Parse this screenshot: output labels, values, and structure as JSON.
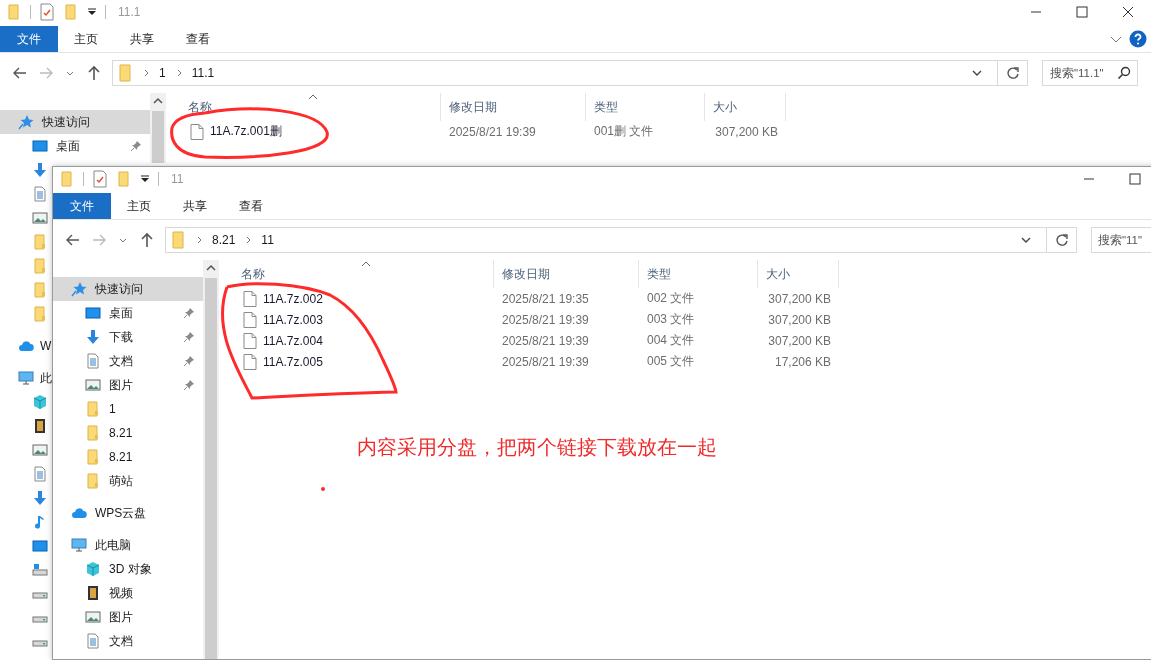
{
  "windows": [
    {
      "title": "11.1",
      "ribbon_tabs": [
        {
          "label": "文件",
          "selected": true
        },
        {
          "label": "主页",
          "selected": false
        },
        {
          "label": "共享",
          "selected": false
        },
        {
          "label": "查看",
          "selected": false
        }
      ],
      "path": [
        "1",
        "11.1"
      ],
      "search": {
        "placeholder": "搜索\"11.1\""
      },
      "nav": [
        {
          "kind": "quick",
          "label": "快速访问",
          "selected": true,
          "children": [
            {
              "kind": "desktop",
              "label": "桌面",
              "pinned": true,
              "selected": false
            },
            {
              "kind": "download",
              "selected": false
            },
            {
              "kind": "doc",
              "selected": false
            },
            {
              "kind": "picture",
              "selected": false
            },
            {
              "kind": "folder",
              "selected": false
            },
            {
              "kind": "folder",
              "selected": false
            },
            {
              "kind": "folder",
              "selected": false
            },
            {
              "kind": "folder",
              "selected": false
            }
          ]
        },
        {
          "kind": "cloud",
          "label": "W",
          "selected": false
        },
        {
          "kind": "pc",
          "label": "此",
          "selected": false,
          "children": [
            {
              "kind": "cube",
              "selected": false
            },
            {
              "kind": "video",
              "selected": false
            },
            {
              "kind": "picture",
              "selected": false
            },
            {
              "kind": "doc",
              "selected": false
            },
            {
              "kind": "download",
              "selected": false
            },
            {
              "kind": "music",
              "selected": false
            },
            {
              "kind": "desktop",
              "selected": false
            },
            {
              "kind": "windrive",
              "selected": false
            },
            {
              "kind": "drive",
              "selected": false
            },
            {
              "kind": "drive",
              "selected": false
            },
            {
              "kind": "drive",
              "selected": false
            }
          ]
        }
      ],
      "columns": [
        "名称",
        "修改日期",
        "类型",
        "大小"
      ],
      "files": [
        {
          "name": "11A.7z.001删",
          "date": "2025/8/21 19:39",
          "type": "001删 文件",
          "size": "307,200 KB"
        }
      ]
    },
    {
      "title": "11",
      "ribbon_tabs": [
        {
          "label": "文件",
          "selected": true
        },
        {
          "label": "主页",
          "selected": false
        },
        {
          "label": "共享",
          "selected": false
        },
        {
          "label": "查看",
          "selected": false
        }
      ],
      "path": [
        "8.21",
        "11"
      ],
      "search": {
        "placeholder": "搜索\"11\""
      },
      "nav": [
        {
          "kind": "quick",
          "label": "快速访问",
          "selected": true,
          "children": [
            {
              "kind": "desktop",
              "label": "桌面",
              "pinned": true,
              "selected": false
            },
            {
              "kind": "download",
              "label": "下载",
              "pinned": true,
              "selected": false
            },
            {
              "kind": "doc",
              "label": "文档",
              "pinned": true,
              "selected": false
            },
            {
              "kind": "picture",
              "label": "图片",
              "pinned": true,
              "selected": false
            },
            {
              "kind": "folder",
              "label": "1",
              "pinned": false,
              "selected": false
            },
            {
              "kind": "folder",
              "label": "8.21",
              "pinned": false,
              "selected": false
            },
            {
              "kind": "folder",
              "label": "8.21",
              "pinned": false,
              "selected": false
            },
            {
              "kind": "folder",
              "label": "萌站",
              "pinned": false,
              "selected": false
            }
          ]
        },
        {
          "kind": "cloud",
          "label": "WPS云盘",
          "selected": false
        },
        {
          "kind": "pc",
          "label": "此电脑",
          "selected": false,
          "children": [
            {
              "kind": "cube",
              "label": "3D 对象",
              "selected": false
            },
            {
              "kind": "video",
              "label": "视频",
              "selected": false
            },
            {
              "kind": "picture",
              "label": "图片",
              "selected": false
            },
            {
              "kind": "doc",
              "label": "文档",
              "selected": false
            }
          ]
        }
      ],
      "columns": [
        "名称",
        "修改日期",
        "类型",
        "大小"
      ],
      "files": [
        {
          "name": "11A.7z.002",
          "date": "2025/8/21 19:35",
          "type": "002 文件",
          "size": "307,200 KB"
        },
        {
          "name": "11A.7z.003",
          "date": "2025/8/21 19:39",
          "type": "003 文件",
          "size": "307,200 KB"
        },
        {
          "name": "11A.7z.004",
          "date": "2025/8/21 19:39",
          "type": "004 文件",
          "size": "307,200 KB"
        },
        {
          "name": "11A.7z.005",
          "date": "2025/8/21 19:39",
          "type": "005 文件",
          "size": "17,206 KB"
        }
      ]
    }
  ],
  "annotation": "内容采用分盘，把两个链接下载放在一起"
}
